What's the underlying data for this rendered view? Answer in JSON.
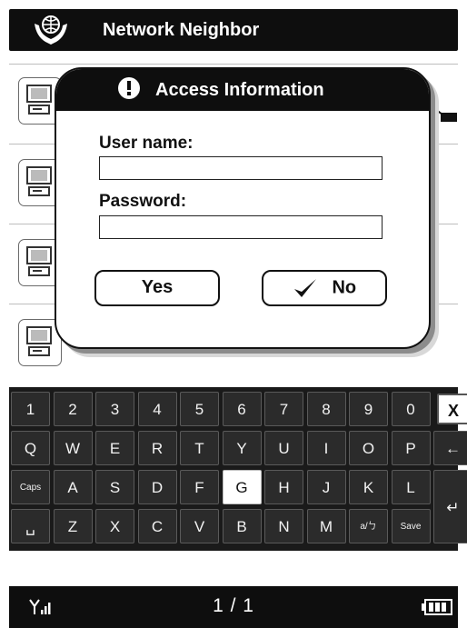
{
  "app": {
    "title": "Network Neighbor",
    "icon": "globe-in-hands-icon"
  },
  "list": {
    "rows": [
      {
        "icon": "computer-icon"
      },
      {
        "icon": "computer-icon"
      },
      {
        "icon": "computer-icon"
      },
      {
        "icon": "computer-icon"
      }
    ]
  },
  "dialog": {
    "title": "Access Information",
    "icon": "exclamation-icon",
    "username_label": "User name:",
    "username_value": "",
    "password_label": "Password:",
    "password_value": "",
    "yes_label": "Yes",
    "no_label": "No",
    "focused_button": "no"
  },
  "keyboard": {
    "row1": [
      "1",
      "2",
      "3",
      "4",
      "5",
      "6",
      "7",
      "8",
      "9",
      "0"
    ],
    "clear": "X",
    "row2": [
      "Q",
      "W",
      "E",
      "R",
      "T",
      "Y",
      "U",
      "I",
      "O",
      "P"
    ],
    "backspace": "←",
    "row3": [
      "Caps",
      "A",
      "S",
      "D",
      "F",
      "G",
      "H",
      "J",
      "K",
      "L"
    ],
    "enter": "↵",
    "row4": [
      "␣",
      "Z",
      "X",
      "C",
      "V",
      "B",
      "N",
      "M",
      "a/ㄅ",
      "Save"
    ],
    "selected_key": "G"
  },
  "status": {
    "page": "1 / 1",
    "signal_icon": "signal-icon",
    "battery_icon": "battery-icon"
  },
  "colors": {
    "bar": "#0e0e0e",
    "key": "#2b2b2b",
    "keyboard_bg": "#1a1a1a"
  }
}
